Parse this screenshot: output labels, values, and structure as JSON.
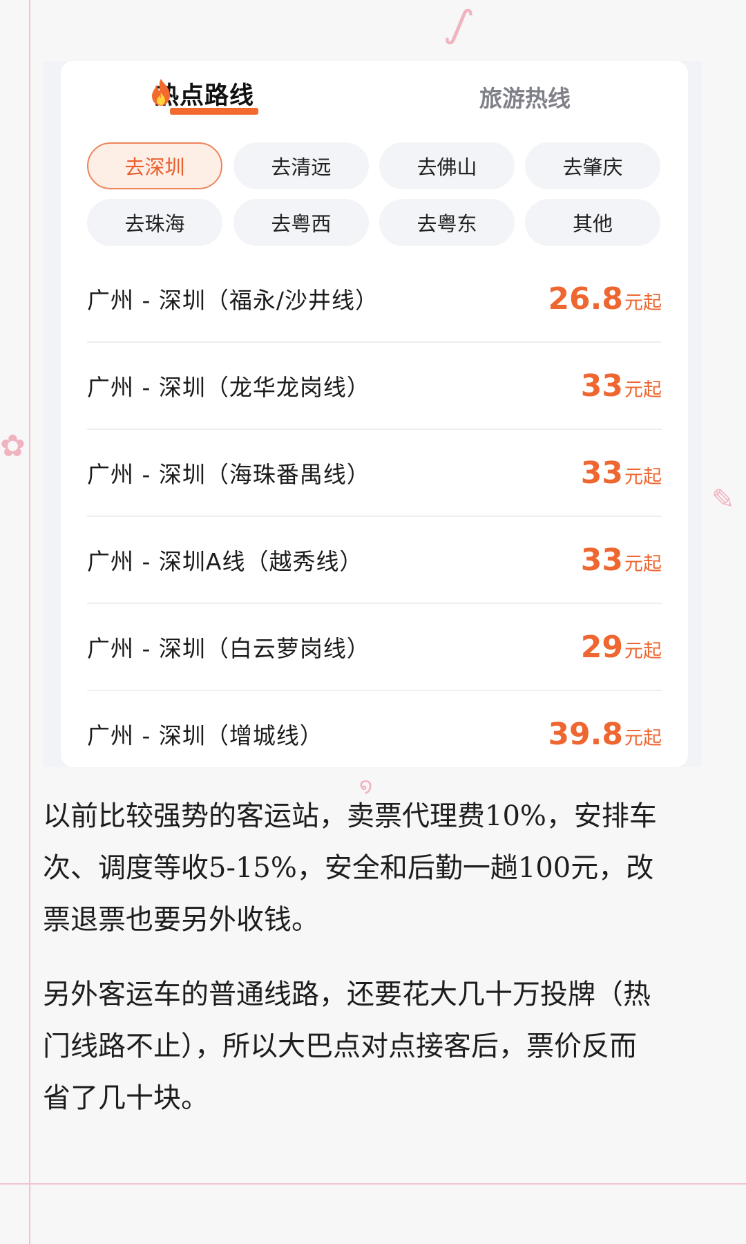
{
  "tabs": {
    "hot_routes": "热点路线",
    "travel_routes": "旅游热线"
  },
  "destinations": [
    "去深圳",
    "去清远",
    "去佛山",
    "去肇庆",
    "去珠海",
    "去粤西",
    "去粤东",
    "其他"
  ],
  "selected_destination": "去深圳",
  "routes": [
    {
      "name": "广州 - 深圳（福永/沙井线）",
      "price": "26.8",
      "unit": "元起"
    },
    {
      "name": "广州 - 深圳（龙华龙岗线）",
      "price": "33",
      "unit": "元起"
    },
    {
      "name": "广州 - 深圳（海珠番禺线）",
      "price": "33",
      "unit": "元起"
    },
    {
      "name": "广州 - 深圳A线（越秀线）",
      "price": "33",
      "unit": "元起"
    },
    {
      "name": "广州 - 深圳（白云萝岗线）",
      "price": "29",
      "unit": "元起"
    },
    {
      "name": "广州 - 深圳（增城线）",
      "price": "39.8",
      "unit": "元起"
    }
  ],
  "article": {
    "p1_lines": [
      "以前比较强势的客运站，卖票代理费10%，安排车",
      "次、调度等收5-15%，安全和后勤一趟100元，改",
      "票退票也要另外收钱。"
    ],
    "p2_lines": [
      "另外客运车的普通线路，还要花大几十万投牌（热",
      "门线路不止），所以大巴点对点接客后，票价反而",
      "省了几十块。"
    ]
  },
  "colors": {
    "accent": "#ee6630",
    "chip_active_bg": "#fdeee6",
    "chip_bg": "#f3f4f7",
    "page_bg": "#f7f7f8",
    "rule": "#f2c3cc"
  }
}
